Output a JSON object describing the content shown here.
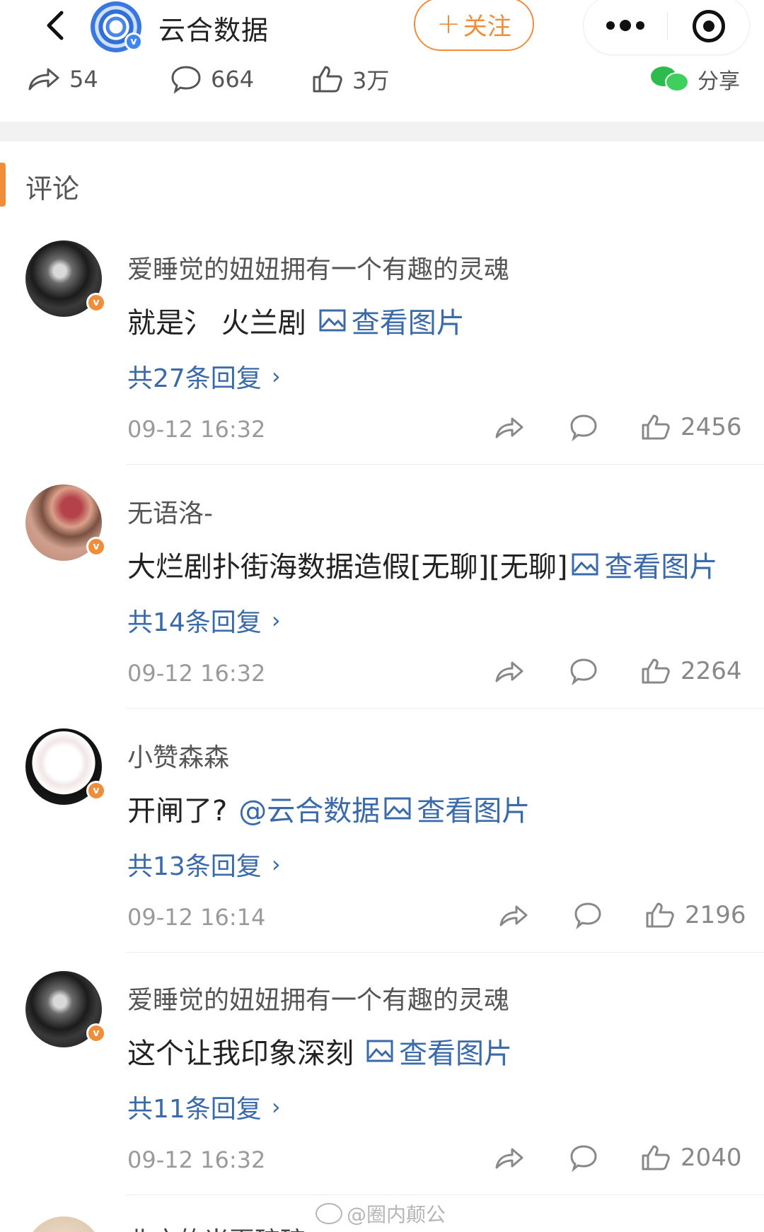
{
  "header": {
    "back_label": "<",
    "account_name": "云合数据",
    "follow_label": "关注",
    "follow_plus": "+",
    "verified_mark": "v"
  },
  "stats": {
    "repost_count": "54",
    "comment_count": "664",
    "like_count": "3万",
    "share_label": "分享"
  },
  "section": {
    "title": "评论"
  },
  "comments": [
    {
      "user": "爱睡觉的妞妞拥有一个有趣的灵魂",
      "text": "就是氵 火兰剧",
      "mention": "",
      "view_pic": "查看图片",
      "replies": "共27条回复",
      "time": "09-12 16:32",
      "likes": "2456",
      "badge": "v"
    },
    {
      "user": "无语洛-",
      "text": "大烂剧扑街海数据造假[无聊][无聊]",
      "mention": "",
      "view_pic": "查看图片",
      "replies": "共14条回复",
      "time": "09-12 16:32",
      "likes": "2264",
      "badge": "v"
    },
    {
      "user": "小赞森森",
      "text": "开闸了?",
      "mention": "@云合数据",
      "view_pic": "查看图片",
      "replies": "共13条回复",
      "time": "09-12 16:14",
      "likes": "2196",
      "badge": "v"
    },
    {
      "user": "爱睡觉的妞妞拥有一个有趣的灵魂",
      "text": "这个让我印象深刻",
      "mention": "",
      "view_pic": "查看图片",
      "replies": "共11条回复",
      "time": "09-12 16:32",
      "likes": "2040",
      "badge": "v"
    }
  ],
  "partial": {
    "text": "北方的当夏碎碎"
  },
  "watermark": {
    "text": "@圈内颠公"
  },
  "colors": {
    "accent_orange": "#f08d3a",
    "link_blue": "#3a6aa8",
    "wechat_green": "#2dbb4e",
    "verified_blue": "#3f86f4"
  },
  "icons": [
    "chevron-left-icon",
    "more-dots-icon",
    "target-close-icon",
    "repost-icon",
    "comment-bubble-icon",
    "thumbs-up-icon",
    "wechat-icon",
    "image-icon",
    "chevron-right-icon",
    "share-arrow-icon"
  ]
}
